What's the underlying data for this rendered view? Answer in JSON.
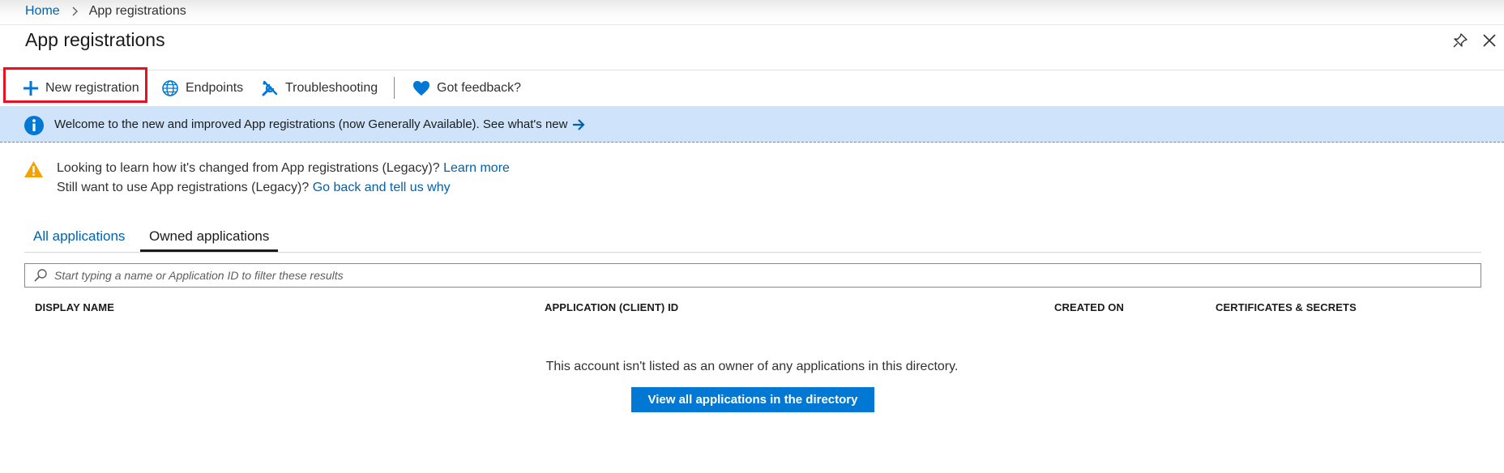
{
  "breadcrumb": {
    "home": "Home",
    "current": "App registrations"
  },
  "page": {
    "title": "App registrations"
  },
  "toolbar": {
    "new_registration": "New registration",
    "endpoints": "Endpoints",
    "troubleshooting": "Troubleshooting",
    "feedback": "Got feedback?"
  },
  "info_banner": {
    "message": "Welcome to the new and improved App registrations (now Generally Available). See what's new"
  },
  "warning": {
    "line1_text": "Looking to learn how it's changed from App registrations (Legacy)?",
    "line1_link": "Learn more",
    "line2_text": "Still want to use App registrations (Legacy)?",
    "line2_link": "Go back and tell us why"
  },
  "tabs": [
    {
      "label": "All applications",
      "active": false
    },
    {
      "label": "Owned applications",
      "active": true
    }
  ],
  "search": {
    "placeholder": "Start typing a name or Application ID to filter these results",
    "value": ""
  },
  "table": {
    "columns": [
      "DISPLAY NAME",
      "APPLICATION (CLIENT) ID",
      "CREATED ON",
      "CERTIFICATES & SECRETS"
    ],
    "rows": []
  },
  "empty_state": {
    "message": "This account isn't listed as an owner of any applications in this directory.",
    "button": "View all applications in the directory"
  },
  "colors": {
    "link": "#0062ad",
    "accent": "#0078d4",
    "banner_bg": "#cfe4fa",
    "highlight": "#e81123",
    "warning": "#f7a100"
  }
}
